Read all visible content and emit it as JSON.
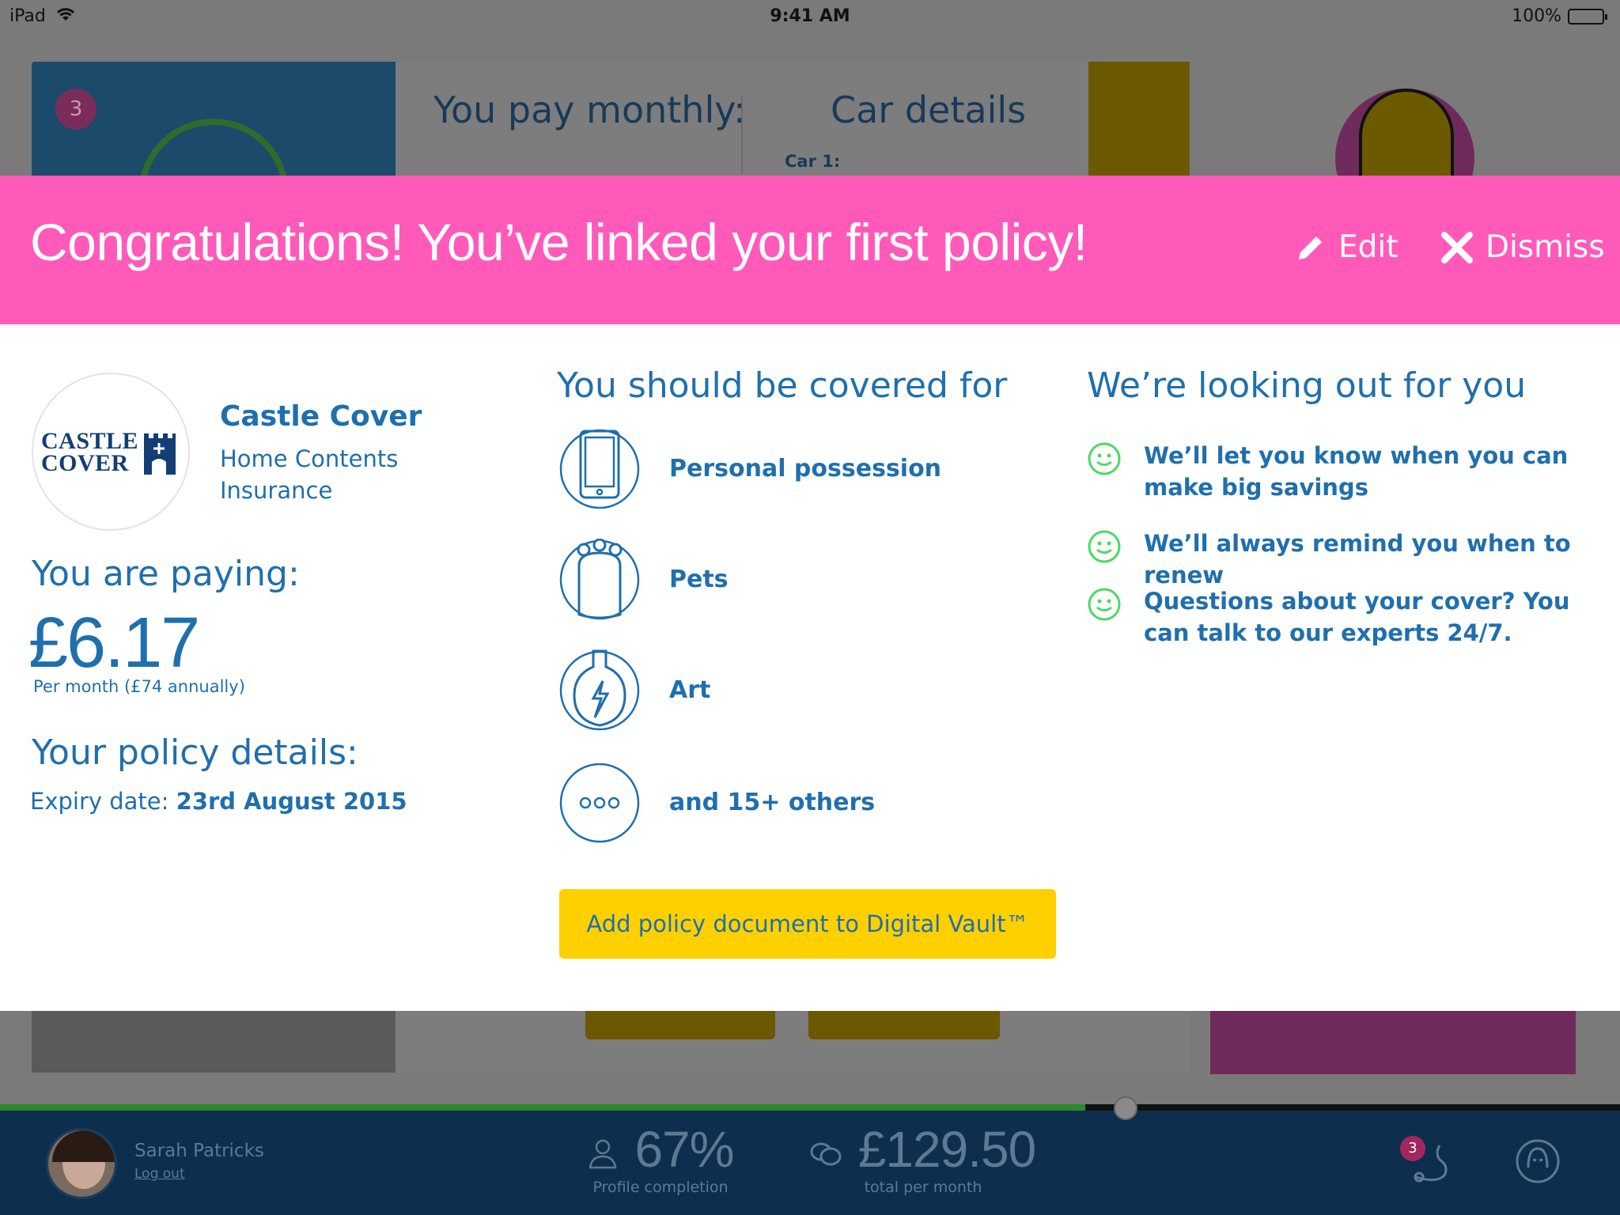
{
  "status_bar": {
    "carrier": "iPad",
    "time": "9:41 AM",
    "battery": "100%"
  },
  "background": {
    "badge_count": "3",
    "pay_monthly": "You pay monthly:",
    "car_details": "Car details",
    "car_1": "Car 1:"
  },
  "banner": {
    "title": "Congratulations! You’ve linked your first policy!",
    "edit_label": "Edit",
    "dismiss_label": "Dismiss",
    "color": "#ff5ab9"
  },
  "provider": {
    "logo_line1": "CASTLE",
    "logo_line2": "COVER",
    "name": "Castle Cover",
    "type": "Home Contents Insurance"
  },
  "payment": {
    "label": "You are paying:",
    "amount": "£6.17",
    "note": "Per month (£74 annually)"
  },
  "policy": {
    "label": "Your policy details:",
    "expiry_label": "Expiry date:",
    "expiry_value": "23rd August 2015"
  },
  "covered": {
    "heading": "You should be covered for",
    "items": [
      {
        "label": "Personal possession",
        "icon": "tablet-icon"
      },
      {
        "label": "Pets",
        "icon": "pet-bowl-icon"
      },
      {
        "label": "Art",
        "icon": "vase-icon"
      },
      {
        "label": "and 15+ others",
        "icon": "more-icon"
      }
    ]
  },
  "lookout": {
    "heading": "We’re looking out for you",
    "items": [
      {
        "text": "We’ll let you know when you can make big savings"
      },
      {
        "text": "We’ll always remind you when to renew"
      },
      {
        "text": "Questions about your cover? You can talk to our experts 24/7."
      }
    ]
  },
  "vault_button": {
    "label": "Add policy document to Digital Vault™",
    "color": "#ffd000"
  },
  "bottom_bar": {
    "user_name": "Sarah Patricks",
    "logout": "Log out",
    "profile_percent": "67%",
    "profile_progress": 0.67,
    "profile_label": "Profile completion",
    "total": "£129.50",
    "total_label": "total per month",
    "notification_count": "3"
  },
  "colors": {
    "accent_blue": "#1f6fae",
    "smile_green": "#4cd964",
    "nav_dark": "#0d2f4d"
  }
}
